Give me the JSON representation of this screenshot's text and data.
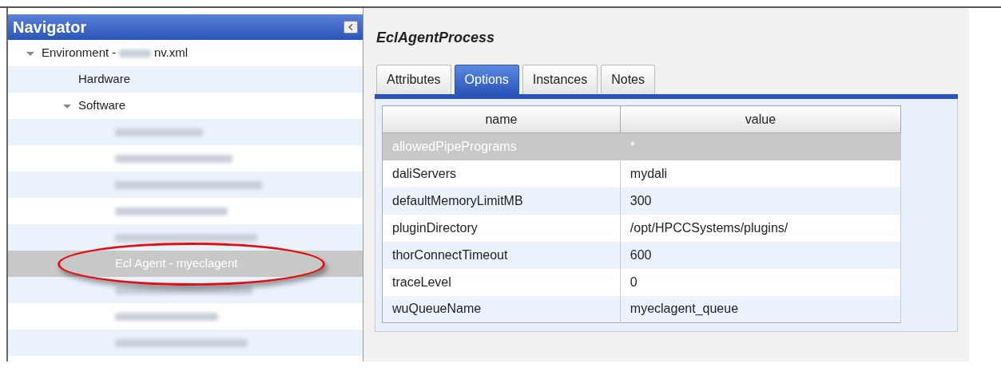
{
  "navigator": {
    "title": "Navigator",
    "tree": [
      {
        "kind": "item",
        "label_prefix": "Environment -",
        "label_suffix": "nv.xml",
        "redacted_part": true,
        "expanded": true,
        "selected": false,
        "children": [
          {
            "kind": "item",
            "label": "Hardware",
            "selected": false
          },
          {
            "kind": "item",
            "label": "Software",
            "expanded": true,
            "selected": false,
            "children": [
              {
                "kind": "redacted",
                "selected": false
              },
              {
                "kind": "redacted",
                "selected": false
              },
              {
                "kind": "redacted",
                "selected": false
              },
              {
                "kind": "redacted",
                "selected": false
              },
              {
                "kind": "redacted",
                "selected": false
              },
              {
                "kind": "item",
                "label": "Ecl Agent - myeclagent",
                "selected": true,
                "circled": true
              },
              {
                "kind": "redacted",
                "selected": false
              },
              {
                "kind": "redacted",
                "selected": false
              },
              {
                "kind": "redacted",
                "selected": false
              }
            ]
          }
        ]
      }
    ]
  },
  "detail": {
    "title": "EclAgentProcess",
    "tabs": [
      {
        "label": "Attributes",
        "selected": false
      },
      {
        "label": "Options",
        "selected": true
      },
      {
        "label": "Instances",
        "selected": false
      },
      {
        "label": "Notes",
        "selected": false
      }
    ],
    "table": {
      "columns": [
        "name",
        "value"
      ],
      "rows": [
        {
          "cells": [
            "allowedPipePrograms",
            "*"
          ],
          "selected": true
        },
        {
          "cells": [
            "daliServers",
            "mydali"
          ],
          "selected": false
        },
        {
          "cells": [
            "defaultMemoryLimitMB",
            "300"
          ],
          "selected": false
        },
        {
          "cells": [
            "pluginDirectory",
            "/opt/HPCCSystems/plugins/"
          ],
          "selected": false
        },
        {
          "cells": [
            "thorConnectTimeout",
            "600"
          ],
          "selected": false
        },
        {
          "cells": [
            "traceLevel",
            "0"
          ],
          "selected": false
        },
        {
          "cells": [
            "wuQueueName",
            "myeclagent_queue"
          ],
          "selected": false
        }
      ]
    }
  }
}
